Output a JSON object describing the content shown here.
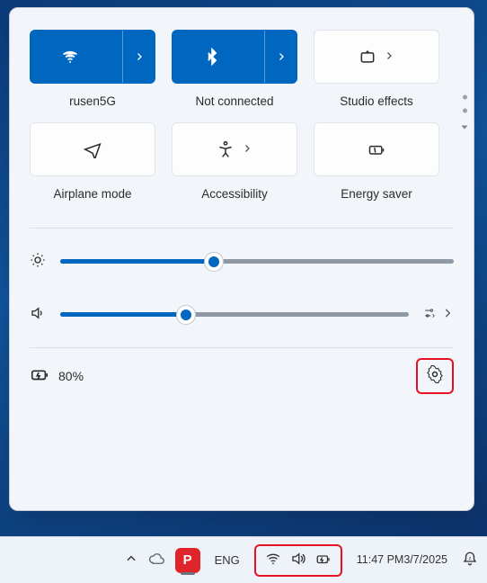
{
  "tiles": [
    {
      "id": "wifi",
      "label": "rusen5G",
      "active": true,
      "hasChevron": true
    },
    {
      "id": "bluetooth",
      "label": "Not connected",
      "active": true,
      "hasChevron": true
    },
    {
      "id": "studio",
      "label": "Studio effects",
      "active": false,
      "hasChevron": true,
      "inlineChevron": true
    },
    {
      "id": "airplane",
      "label": "Airplane mode",
      "active": false,
      "hasChevron": false
    },
    {
      "id": "accessibility",
      "label": "Accessibility",
      "active": false,
      "hasChevron": true,
      "inlineChevron": true
    },
    {
      "id": "energy",
      "label": "Energy saver",
      "active": false,
      "hasChevron": false
    }
  ],
  "brightness": {
    "percent": 39
  },
  "volume": {
    "percent": 36
  },
  "battery": {
    "label": "80%"
  },
  "taskbar": {
    "language": "ENG",
    "clock_time": "11:47 PM",
    "clock_date": "3/7/2025"
  }
}
